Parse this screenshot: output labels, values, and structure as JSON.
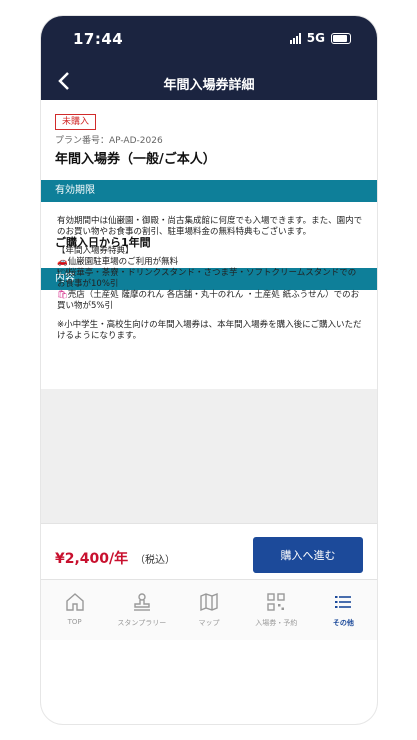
{
  "status": {
    "time": "17:44",
    "network": "5G"
  },
  "header": {
    "title": "年間入場券詳細"
  },
  "ticket": {
    "badge": "未購入",
    "plan_number": "プラン番号：AP-AD-2026",
    "title": "年間入場券（一般/ご本人）"
  },
  "sections": {
    "validity_head": "有効期限",
    "validity_text": "ご購入日から1年間",
    "content_head": "内容"
  },
  "description": {
    "p1": "有効期間中は仙巌園・御殿・尚古集成館に何度でも入場できます。また、園内でのお買い物やお食事の割引、駐車場料金の無料特典もございます。",
    "benefits_title": "【年間入場券特典】",
    "benefit1": "仙巌園駐車場のご利用が無料",
    "benefit2": "桜華亭・茶寮・ドリンクスタンド・さつま芋・ソフトクリームスタンドでのお食事が10%引",
    "benefit3": "売店（土産処 薩摩のれん 各店舗・丸十のれん ・土産処 紙ふうせん）でのお買い物が5%引",
    "note": "※小中学生・高校生向けの年間入場券は、本年間入場券を購入後にご購入いただけるようになります。"
  },
  "purchase": {
    "price": "¥2,400/年",
    "tax": "（税込）",
    "button": "購入へ進む"
  },
  "tabbar": {
    "items": [
      {
        "label": "TOP",
        "icon": "home-icon"
      },
      {
        "label": "スタンプラリー",
        "icon": "stamp-icon"
      },
      {
        "label": "マップ",
        "icon": "map-icon"
      },
      {
        "label": "入場券・予約",
        "icon": "qr-code-icon"
      },
      {
        "label": "その他",
        "icon": "menu-list-icon"
      }
    ]
  },
  "colors": {
    "navy": "#1b2440",
    "teal": "#0e7f99",
    "price_red": "#c8102e",
    "button_blue": "#1c4a9a"
  }
}
